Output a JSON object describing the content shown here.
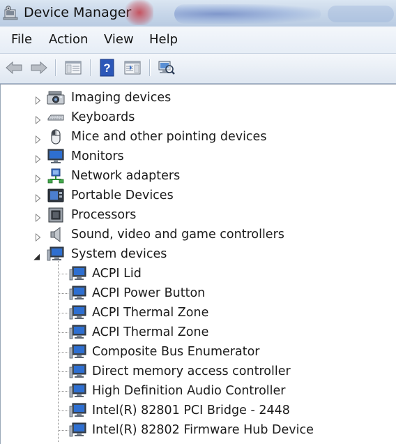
{
  "window": {
    "title": "Device Manager"
  },
  "menu": [
    "File",
    "Action",
    "View",
    "Help"
  ],
  "toolbar": {
    "buttons": [
      "back-arrow-icon",
      "forward-arrow-icon",
      "show-hide-console-tree-icon",
      "help-icon",
      "properties-pane-icon",
      "scan-hardware-icon"
    ]
  },
  "tree": {
    "categories": [
      {
        "label": "Imaging devices",
        "icon": "camera-icon",
        "expanded": false
      },
      {
        "label": "Keyboards",
        "icon": "keyboard-icon",
        "expanded": false
      },
      {
        "label": "Mice and other pointing devices",
        "icon": "mouse-icon",
        "expanded": false
      },
      {
        "label": "Monitors",
        "icon": "monitor-icon",
        "expanded": false
      },
      {
        "label": "Network adapters",
        "icon": "network-adapter-icon",
        "expanded": false
      },
      {
        "label": "Portable Devices",
        "icon": "portable-device-icon",
        "expanded": false
      },
      {
        "label": "Processors",
        "icon": "processor-icon",
        "expanded": false
      },
      {
        "label": "Sound, video and game controllers",
        "icon": "speaker-icon",
        "expanded": false
      },
      {
        "label": "System devices",
        "icon": "system-device-icon",
        "expanded": true
      }
    ],
    "system_devices": [
      "ACPI Lid",
      "ACPI Power Button",
      "ACPI Thermal Zone",
      "ACPI Thermal Zone",
      "Composite Bus Enumerator",
      "Direct memory access controller",
      "High Definition Audio Controller",
      "Intel(R) 82801 PCI Bridge - 2448",
      "Intel(R) 82802 Firmware Hub Device"
    ]
  }
}
